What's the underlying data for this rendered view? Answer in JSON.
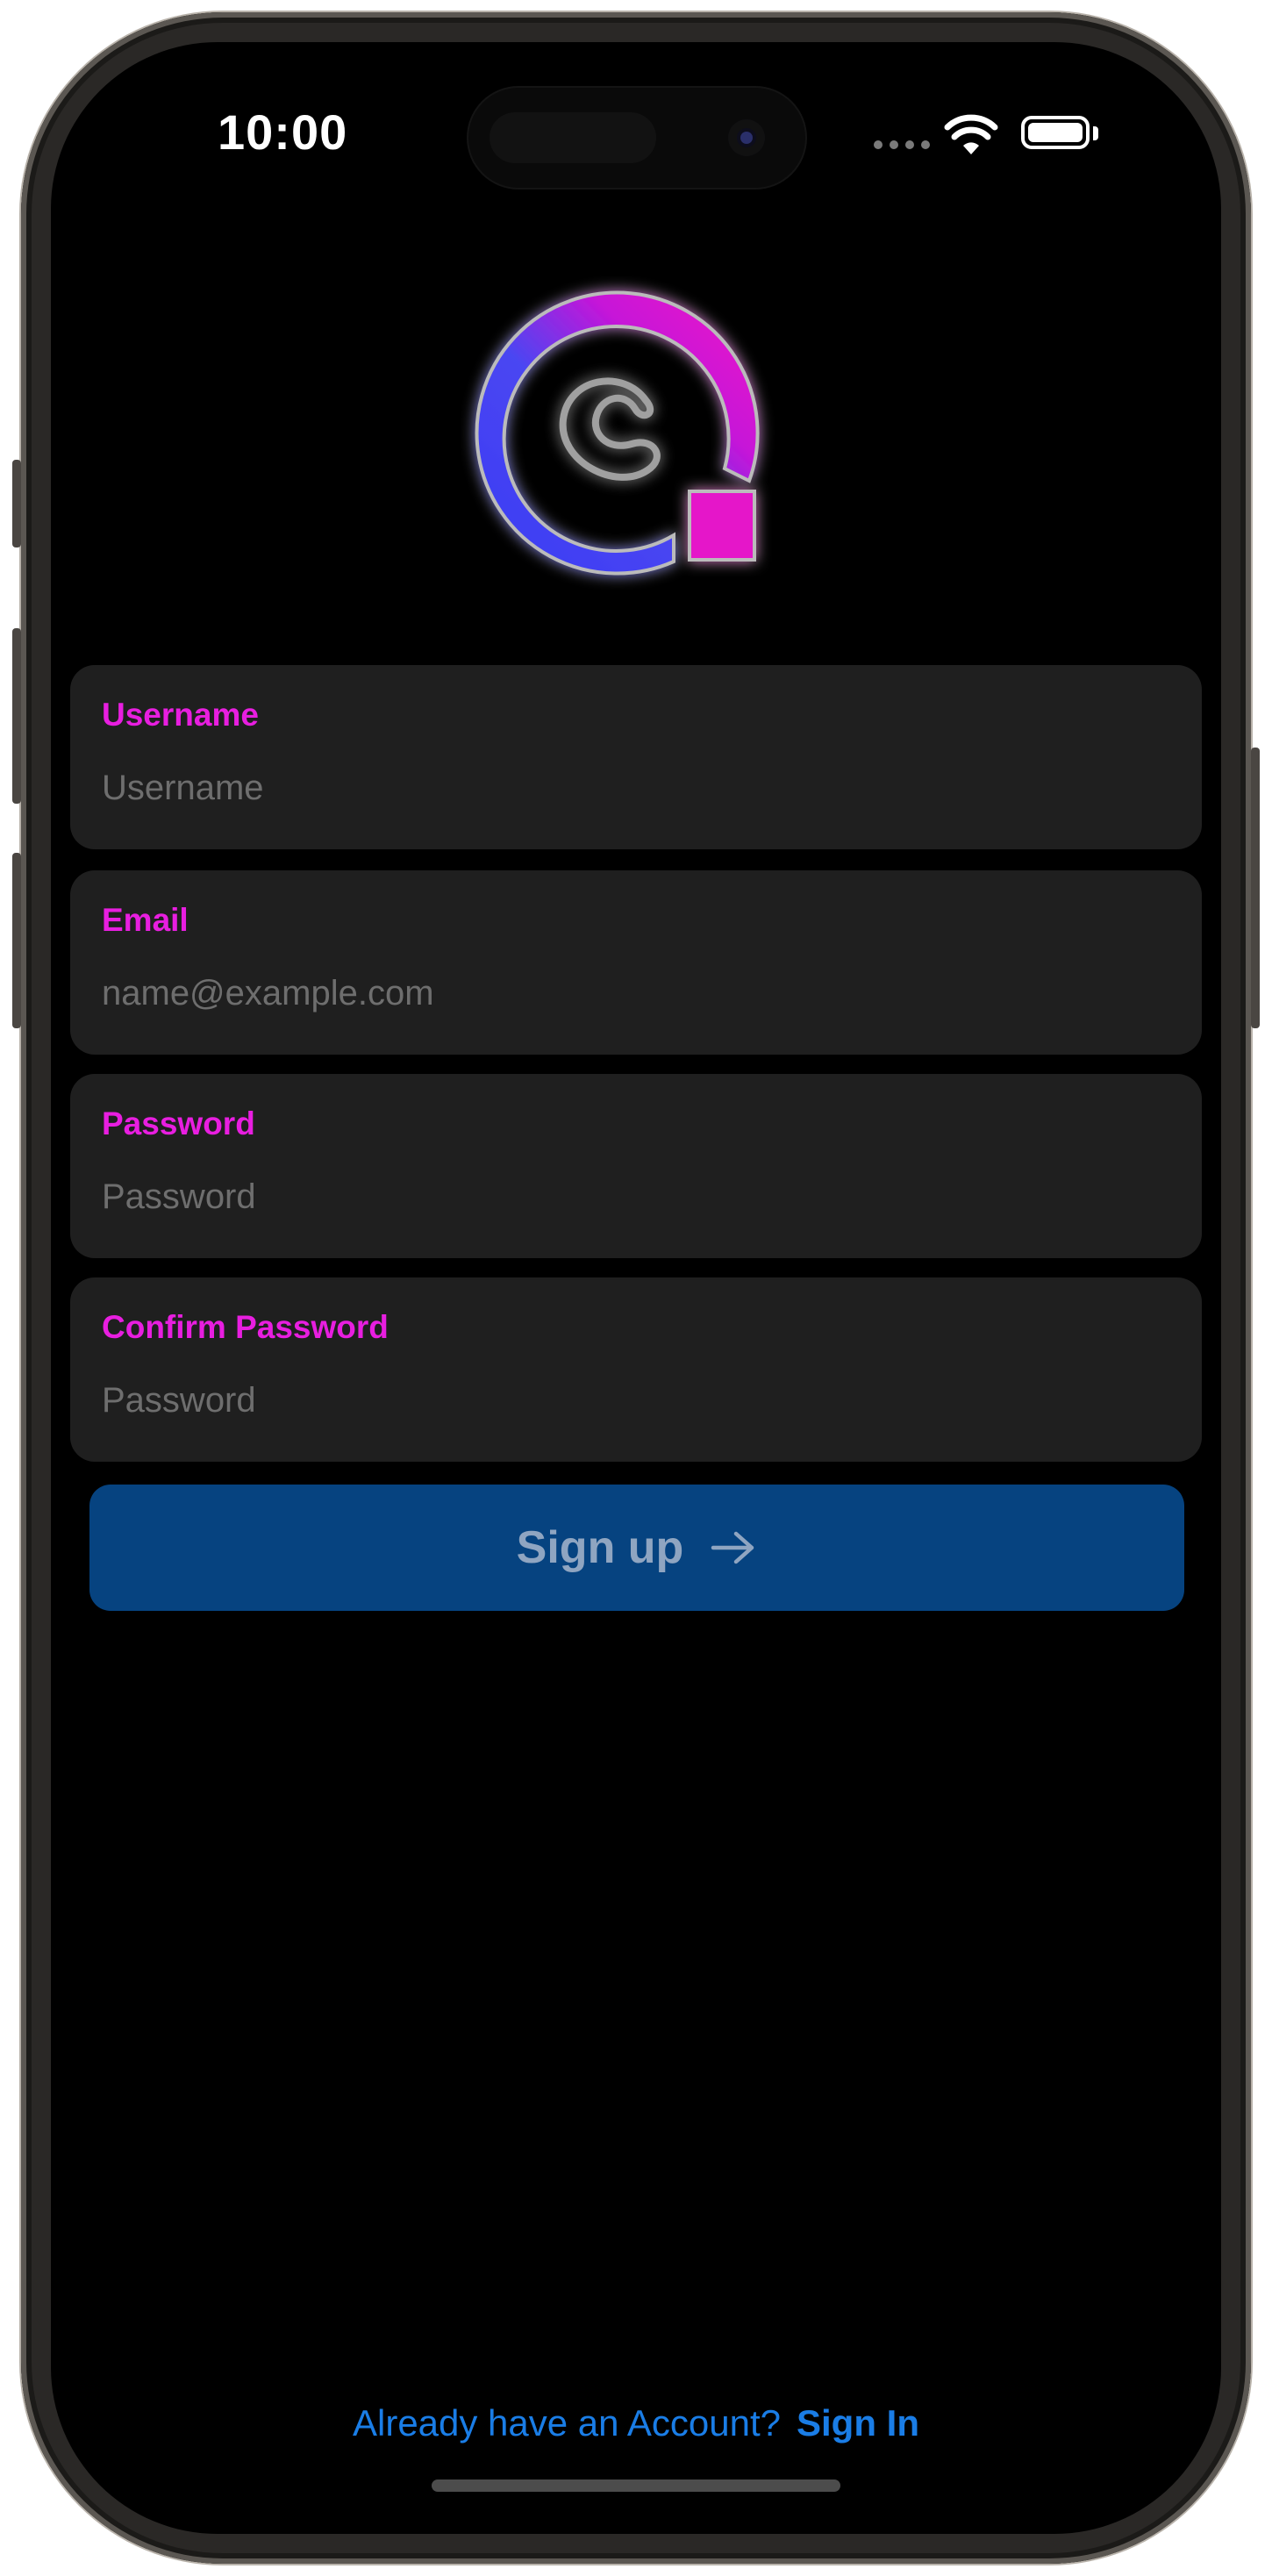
{
  "status_bar": {
    "time": "10:00"
  },
  "logo": {
    "icon": "app-logo-icon"
  },
  "form": {
    "fields": [
      {
        "label": "Username",
        "placeholder": "Username",
        "value": ""
      },
      {
        "label": "Email",
        "placeholder": "name@example.com",
        "value": ""
      },
      {
        "label": "Password",
        "placeholder": "Password",
        "value": ""
      },
      {
        "label": "Confirm Password",
        "placeholder": "Password",
        "value": ""
      }
    ],
    "submit_label": "Sign up"
  },
  "footer": {
    "prompt": "Already have an Account?",
    "link": "Sign In"
  },
  "colors": {
    "label": "#e81ee0",
    "button_bg": "#064380",
    "link": "#1a7de6",
    "field_bg": "#1f1f1f"
  }
}
